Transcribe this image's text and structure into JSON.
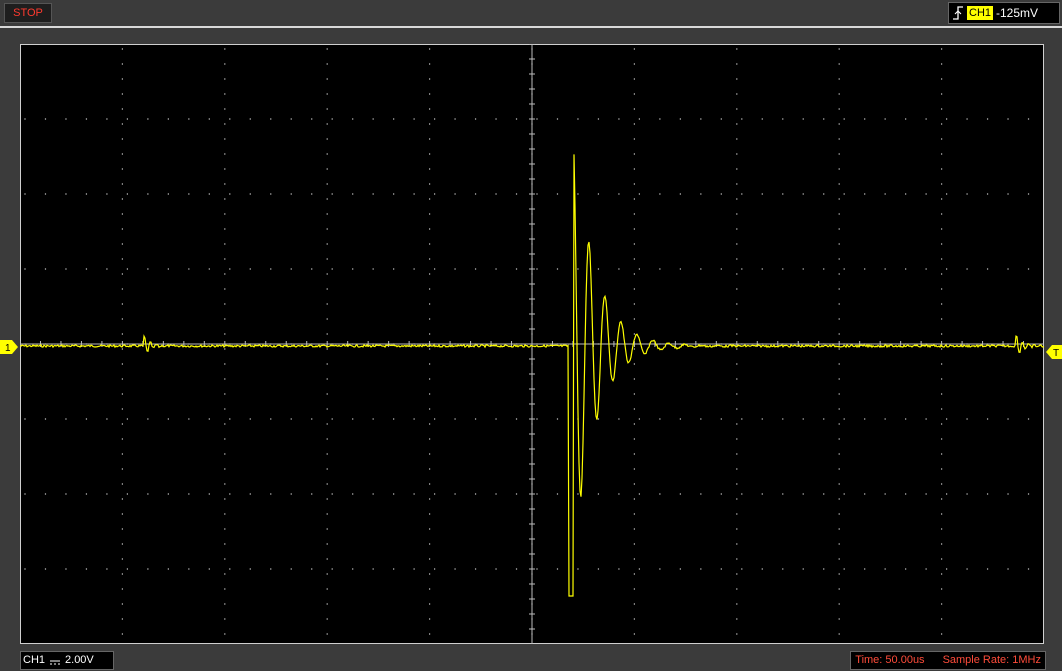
{
  "status": {
    "run_state": "STOP"
  },
  "trigger": {
    "source": "CH1",
    "level": "-125mV",
    "edge_icon": "rising-edge-icon"
  },
  "markers": {
    "channel": "1",
    "trigger": "T"
  },
  "footer": {
    "ch1_label": "CH1",
    "ch1_coupling_icon": "dc-coupling-icon",
    "ch1_scale": "2.00V",
    "time": "Time: 50.00us",
    "sample_rate": "Sample Rate: 1MHz"
  },
  "colors": {
    "trace": "#ffff00",
    "stop": "#ff3a2f",
    "status_text": "#ff4c3a",
    "grid": "#cfcfcf"
  }
}
